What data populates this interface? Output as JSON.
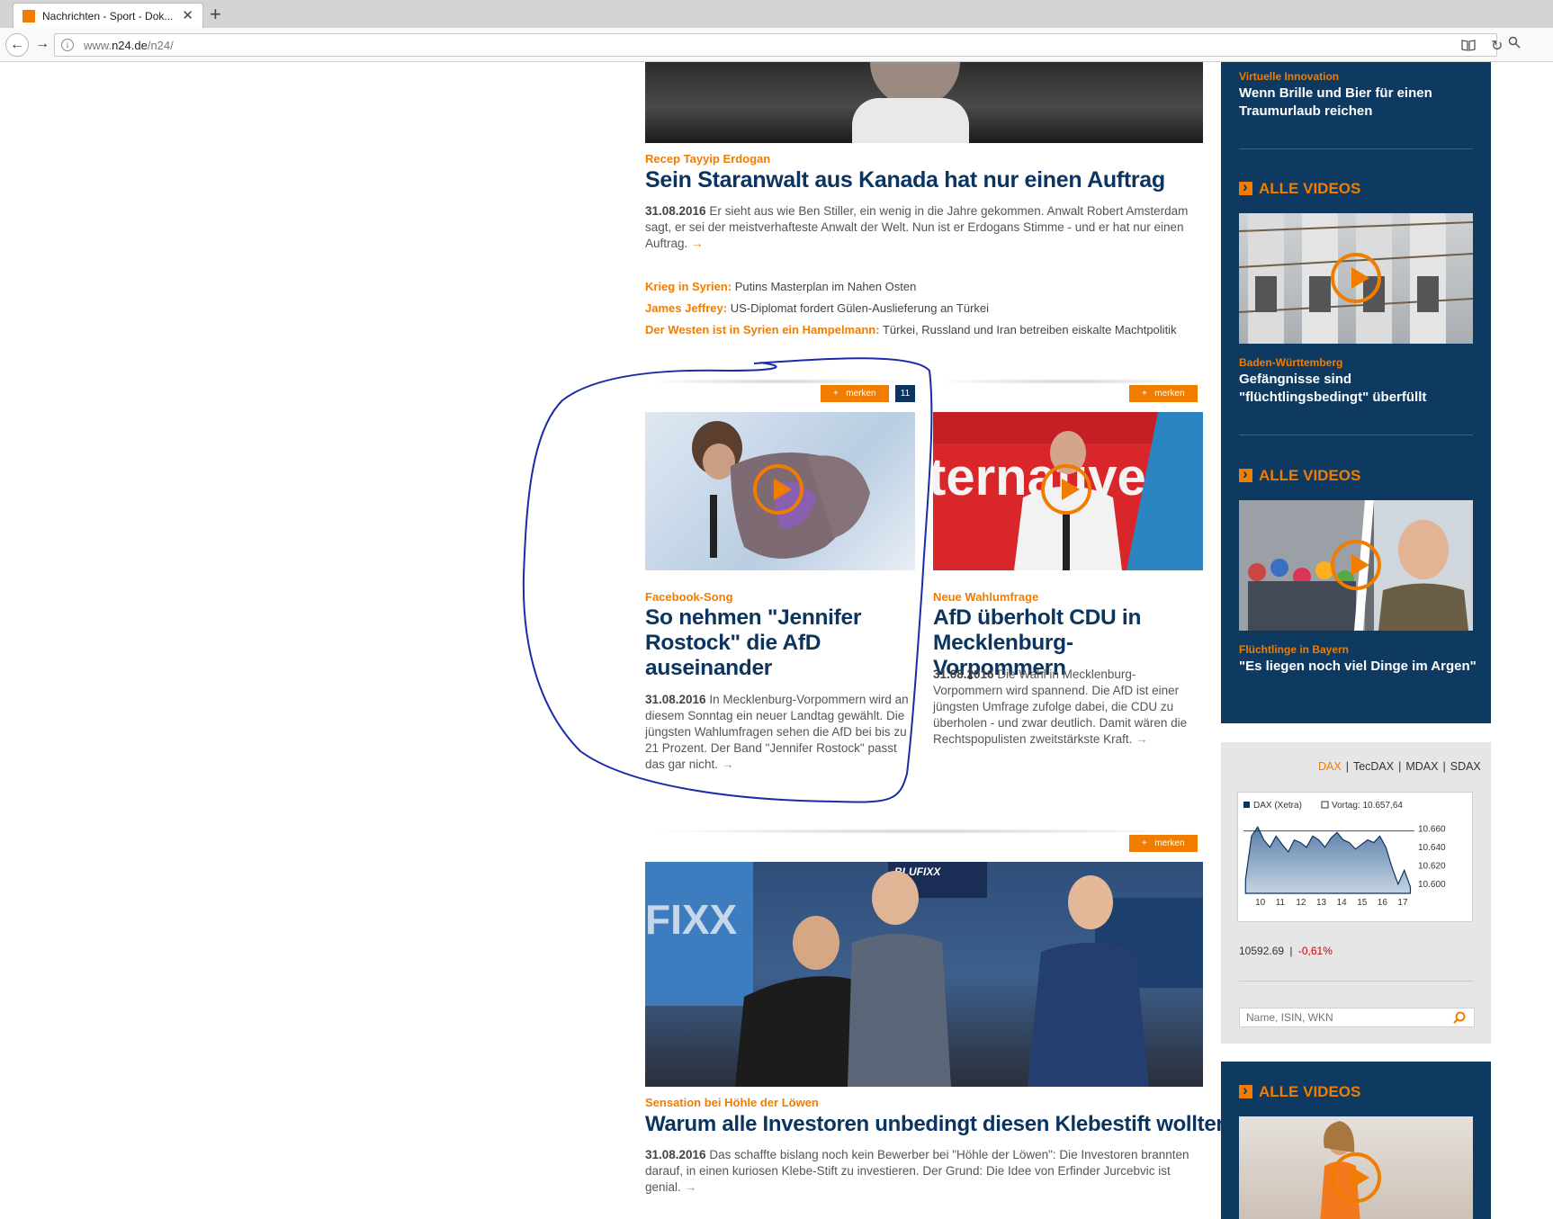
{
  "browser": {
    "tab_title": "Nachrichten - Sport - Dok...",
    "url_prefix": "www.",
    "url_domain": "n24.de",
    "url_path": "/n24/"
  },
  "lead": {
    "kicker": "Recep Tayyip Erdogan",
    "title": "Sein Staranwalt aus Kanada hat nur einen Auftrag",
    "date": "31.08.2016",
    "text": "Er sieht aus wie Ben Stiller, ein wenig in die Jahre gekommen. Anwalt Robert Amsterdam sagt, er sei der meistverhafteste Anwalt der Welt. Nun ist er Erdogans Stimme - und er hat nur einen Auftrag."
  },
  "related_links": [
    {
      "label": "Krieg in Syrien:",
      "text": "Putins Masterplan im Nahen Osten"
    },
    {
      "label": "James Jeffrey:",
      "text": "US-Diplomat fordert Gülen-Auslieferung an Türkei"
    },
    {
      "label": "Der Westen ist in Syrien ein Hampelmann:",
      "text": "Türkei, Russland und Iran betreiben eiskalte Machtpolitik"
    }
  ],
  "merken_label": "merken",
  "card_left": {
    "count": "11",
    "kicker": "Facebook-Song",
    "title": "So nehmen \"Jennifer Rostock\" die AfD auseinander",
    "date": "31.08.2016",
    "text": "In Mecklenburg-Vorpommern wird an diesem Sonntag ein neuer Landtag gewählt. Die jüngsten Wahlumfragen sehen die AfD bei bis zu 21 Prozent. Der Band \"Jennifer Rostock\" passt das gar nicht."
  },
  "card_right": {
    "kicker": "Neue Wahlumfrage",
    "title": "AfD überholt CDU in Mecklenburg-Vorpommern",
    "date": "31.08.2016",
    "text": "Die Wahl in Mecklenburg-Vorpommern wird spannend. Die AfD ist einer jüngsten Umfrage zufolge dabei, die CDU zu überholen - und zwar deutlich. Damit wären die Rechtspopulisten zweitstärkste Kraft."
  },
  "story3": {
    "kicker": "Sensation bei Höhle der Löwen",
    "title": "Warum alle Investoren unbedingt diesen Klebestift wollten",
    "date": "31.08.2016",
    "text": "Das schaffte bislang noch kein Bewerber bei \"Höhle der Löwen\": Die Investoren brannten darauf, in einen kuriosen Klebe-Stift zu investieren. Der Grund: Die Idee von Erfinder Jurcebvic ist genial.",
    "img_text": "BLUFIXX"
  },
  "sidebar": {
    "top_kicker": "Virtuelle Innovation",
    "top_title": "Wenn Brille und Bier für einen Traumurlaub reichen",
    "all_videos_label": "ALLE VIDEOS",
    "video1": {
      "kicker": "Baden-Württemberg",
      "title": "Gefängnisse sind \"flüchtlingsbedingt\" überfüllt"
    },
    "video2": {
      "kicker": "Flüchtlinge in Bayern",
      "title": "\"Es liegen noch viel Dinge im Argen\""
    }
  },
  "dax": {
    "tabs": [
      "DAX",
      "TecDAX",
      "MDAX",
      "SDAX"
    ],
    "active_tab": "DAX",
    "value": "10592.69",
    "change": "-0,61%",
    "search_placeholder": "Name, ISIN, WKN",
    "accent": "#f07d00",
    "negative_color": "#d00000"
  },
  "chart_data": {
    "type": "area",
    "legend": [
      "DAX (Xetra)",
      "Vortag: 10.657,64"
    ],
    "x_ticks": [
      "10",
      "11",
      "12",
      "13",
      "14",
      "15",
      "16",
      "17"
    ],
    "y_ticks": [
      "10.660",
      "10.640",
      "10.620",
      "10.600"
    ],
    "ylim": [
      10590,
      10670
    ],
    "x": [
      9.3,
      9.6,
      9.9,
      10.2,
      10.5,
      10.8,
      11.1,
      11.4,
      11.7,
      12.0,
      12.3,
      12.6,
      12.9,
      13.2,
      13.5,
      13.8,
      14.1,
      14.4,
      14.7,
      15.0,
      15.3,
      15.6,
      15.9,
      16.2,
      16.5,
      16.8,
      17.1,
      17.4
    ],
    "values": [
      10605,
      10652,
      10662,
      10648,
      10640,
      10652,
      10643,
      10635,
      10648,
      10645,
      10640,
      10652,
      10648,
      10640,
      10650,
      10656,
      10648,
      10645,
      10638,
      10643,
      10648,
      10645,
      10652,
      10640,
      10618,
      10600,
      10615,
      10597
    ],
    "prev_close": 10657.64
  }
}
